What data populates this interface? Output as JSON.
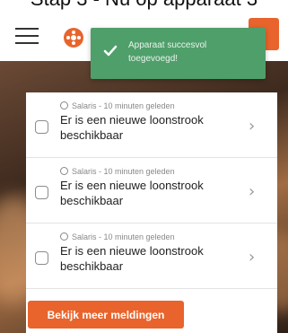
{
  "page_heading": "Stap 3 - Nu op apparaat 3",
  "brand": {
    "logo_icon": "orange-flower-logo-icon",
    "color": "#e8642c"
  },
  "topbar": {
    "menu_icon": "hamburger-menu-icon",
    "action_icon": "orange-action-button-icon"
  },
  "toast": {
    "message": "Apparaat succesvol toegevoegd!",
    "icon": "checkmark-icon",
    "color": "#4f9f6a"
  },
  "notifications": {
    "items": [
      {
        "meta": "Salaris - 10 minuten geleden",
        "title": "Er is een nieuwe loonstrook beschikbaar"
      },
      {
        "meta": "Salaris - 10 minuten geleden",
        "title": "Er is een nieuwe loonstrook beschikbaar"
      },
      {
        "meta": "Salaris - 10 minuten geleden",
        "title": "Er is een nieuwe loonstrook beschikbaar"
      }
    ],
    "more_button": "Bekijk meer meldingen"
  }
}
